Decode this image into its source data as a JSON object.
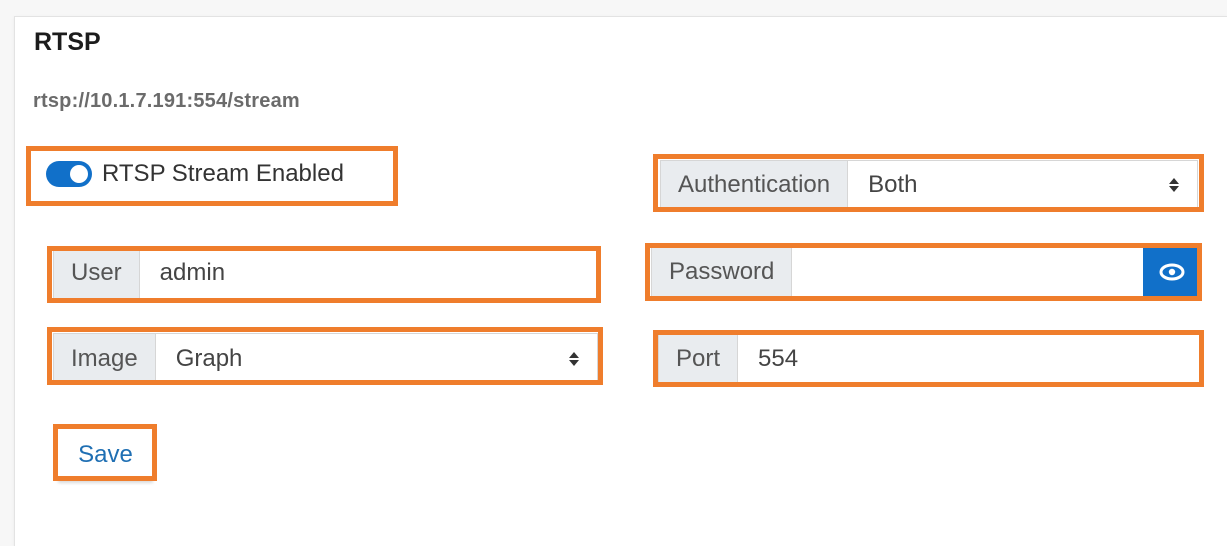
{
  "section": {
    "title": "RTSP",
    "url": "rtsp://10.1.7.191:554/stream"
  },
  "stream_toggle": {
    "label": "RTSP Stream Enabled",
    "enabled": true
  },
  "authentication": {
    "label": "Authentication",
    "value": "Both"
  },
  "user": {
    "label": "User",
    "value": "admin"
  },
  "password": {
    "label": "Password",
    "value": ""
  },
  "image": {
    "label": "Image",
    "value": "Graph"
  },
  "port": {
    "label": "Port",
    "value": "554"
  },
  "save": {
    "label": "Save"
  },
  "icons": {
    "reveal": "eye-icon",
    "select": "sort-caret-icon"
  },
  "colors": {
    "accent": "#1170c9",
    "highlight": "#ef7d2c",
    "addon_bg": "#e9ecef"
  }
}
